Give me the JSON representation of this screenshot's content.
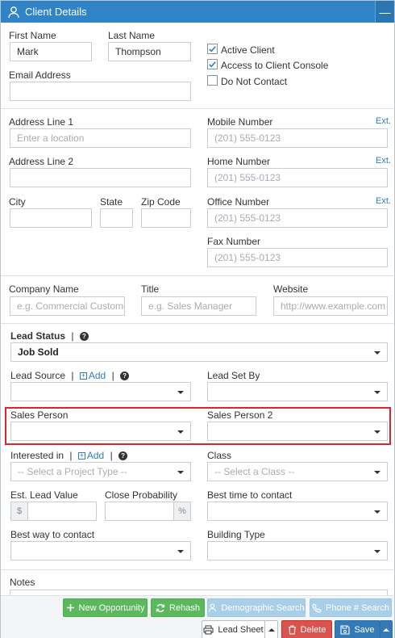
{
  "window": {
    "title": "Client Details",
    "collapse_icon": "minus-icon"
  },
  "fields": {
    "first_name": {
      "label": "First Name",
      "value": "Mark"
    },
    "last_name": {
      "label": "Last Name",
      "value": "Thompson"
    },
    "email": {
      "label": "Email Address",
      "value": ""
    },
    "address1": {
      "label": "Address Line 1",
      "placeholder": "Enter a location"
    },
    "address2": {
      "label": "Address Line 2",
      "value": ""
    },
    "city": {
      "label": "City",
      "value": ""
    },
    "state": {
      "label": "State",
      "value": ""
    },
    "zip": {
      "label": "Zip Code",
      "value": ""
    },
    "mobile": {
      "label": "Mobile Number",
      "placeholder": "(201) 555-0123",
      "ext": "Ext."
    },
    "home": {
      "label": "Home Number",
      "placeholder": "(201) 555-0123",
      "ext": "Ext."
    },
    "office": {
      "label": "Office Number",
      "placeholder": "(201) 555-0123",
      "ext": "Ext."
    },
    "fax": {
      "label": "Fax Number",
      "placeholder": "(201) 555-0123"
    },
    "company": {
      "label": "Company Name",
      "placeholder": "e.g. Commercial Customer, M"
    },
    "title": {
      "label": "Title",
      "placeholder": "e.g. Sales Manager"
    },
    "website": {
      "label": "Website",
      "placeholder": "http://www.example.com"
    }
  },
  "checkboxes": [
    {
      "label": "Active Client",
      "checked": true
    },
    {
      "label": "Access to Client Console",
      "checked": true
    },
    {
      "label": "Do Not Contact",
      "checked": false
    }
  ],
  "lead": {
    "status_label": "Lead Status",
    "status_value": "Job Sold",
    "source_label": "Lead Source",
    "add_label": "Add",
    "set_by_label": "Lead Set By",
    "sales_person_label": "Sales Person",
    "sales_person2_label": "Sales Person 2",
    "interested_label": "Interested in",
    "interested_placeholder": "-- Select a Project Type --",
    "class_label": "Class",
    "class_placeholder": "-- Select a Class --",
    "est_value_label": "Est. Lead Value",
    "currency_symbol": "$",
    "close_prob_label": "Close Probability",
    "percent_symbol": "%",
    "best_time_label": "Best time to contact",
    "best_way_label": "Best way to contact",
    "building_type_label": "Building Type",
    "notes_label": "Notes"
  },
  "buttons": {
    "new_opportunity": "New Opportunity",
    "rehash": "Rehash",
    "demographic_search": "Demographic Search",
    "phone_search": "Phone # Search",
    "lead_sheet": "Lead Sheet",
    "delete": "Delete",
    "save": "Save"
  },
  "colors": {
    "titlebar": "#2f83c6",
    "highlight": "#d9262e",
    "green": "#5cb85c",
    "red": "#d9534f",
    "blue": "#337ab7"
  }
}
